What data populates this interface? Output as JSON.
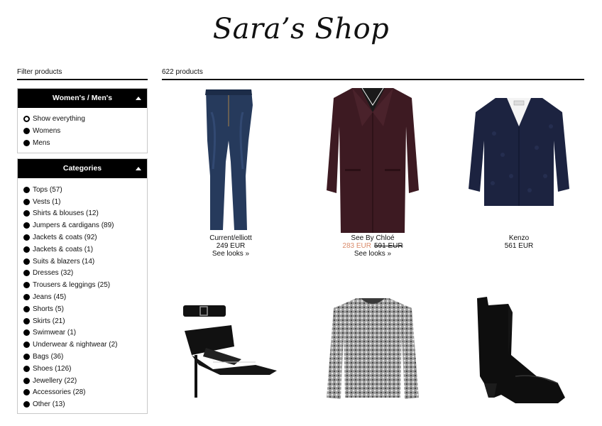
{
  "shop": {
    "title": "Sara’s Shop"
  },
  "sidebar": {
    "heading": "Filter products",
    "gender": {
      "title": "Women's / Men's",
      "options": [
        "Show everything",
        "Womens",
        "Mens"
      ],
      "selected": "Show everything"
    },
    "categories": {
      "title": "Categories",
      "items": [
        "Tops (57)",
        "Vests (1)",
        "Shirts & blouses (12)",
        "Jumpers & cardigans (89)",
        "Jackets & coats (92)",
        "Jackets & coats (1)",
        "Suits & blazers (14)",
        "Dresses (32)",
        "Trousers & leggings (25)",
        "Jeans (45)",
        "Shorts (5)",
        "Skirts (21)",
        "Swimwear (1)",
        "Underwear & nightwear (2)",
        "Bags (36)",
        "Shoes (126)",
        "Jewellery (22)",
        "Accessories (28)",
        "Other (13)"
      ]
    }
  },
  "main": {
    "count": "622 products",
    "products": [
      {
        "brand": "Current/elliott",
        "price": "249 EUR",
        "looks": "See looks »",
        "icon": "jeans-image"
      },
      {
        "brand": "See By Chloé",
        "sale_price": "283 EUR",
        "old_price": "591 EUR",
        "looks": "See looks »",
        "icon": "coat-image"
      },
      {
        "brand": "Kenzo",
        "price": "561 EUR",
        "icon": "bouclé-coat-image"
      },
      {
        "icon": "heels-image"
      },
      {
        "icon": "sweater-image"
      },
      {
        "icon": "ankle-boot-image"
      }
    ]
  },
  "colors": {
    "accent": "#000000",
    "sale": "#d98a6a",
    "coat_burgundy": "#3d1a22",
    "coat_navy": "#1c2340"
  }
}
